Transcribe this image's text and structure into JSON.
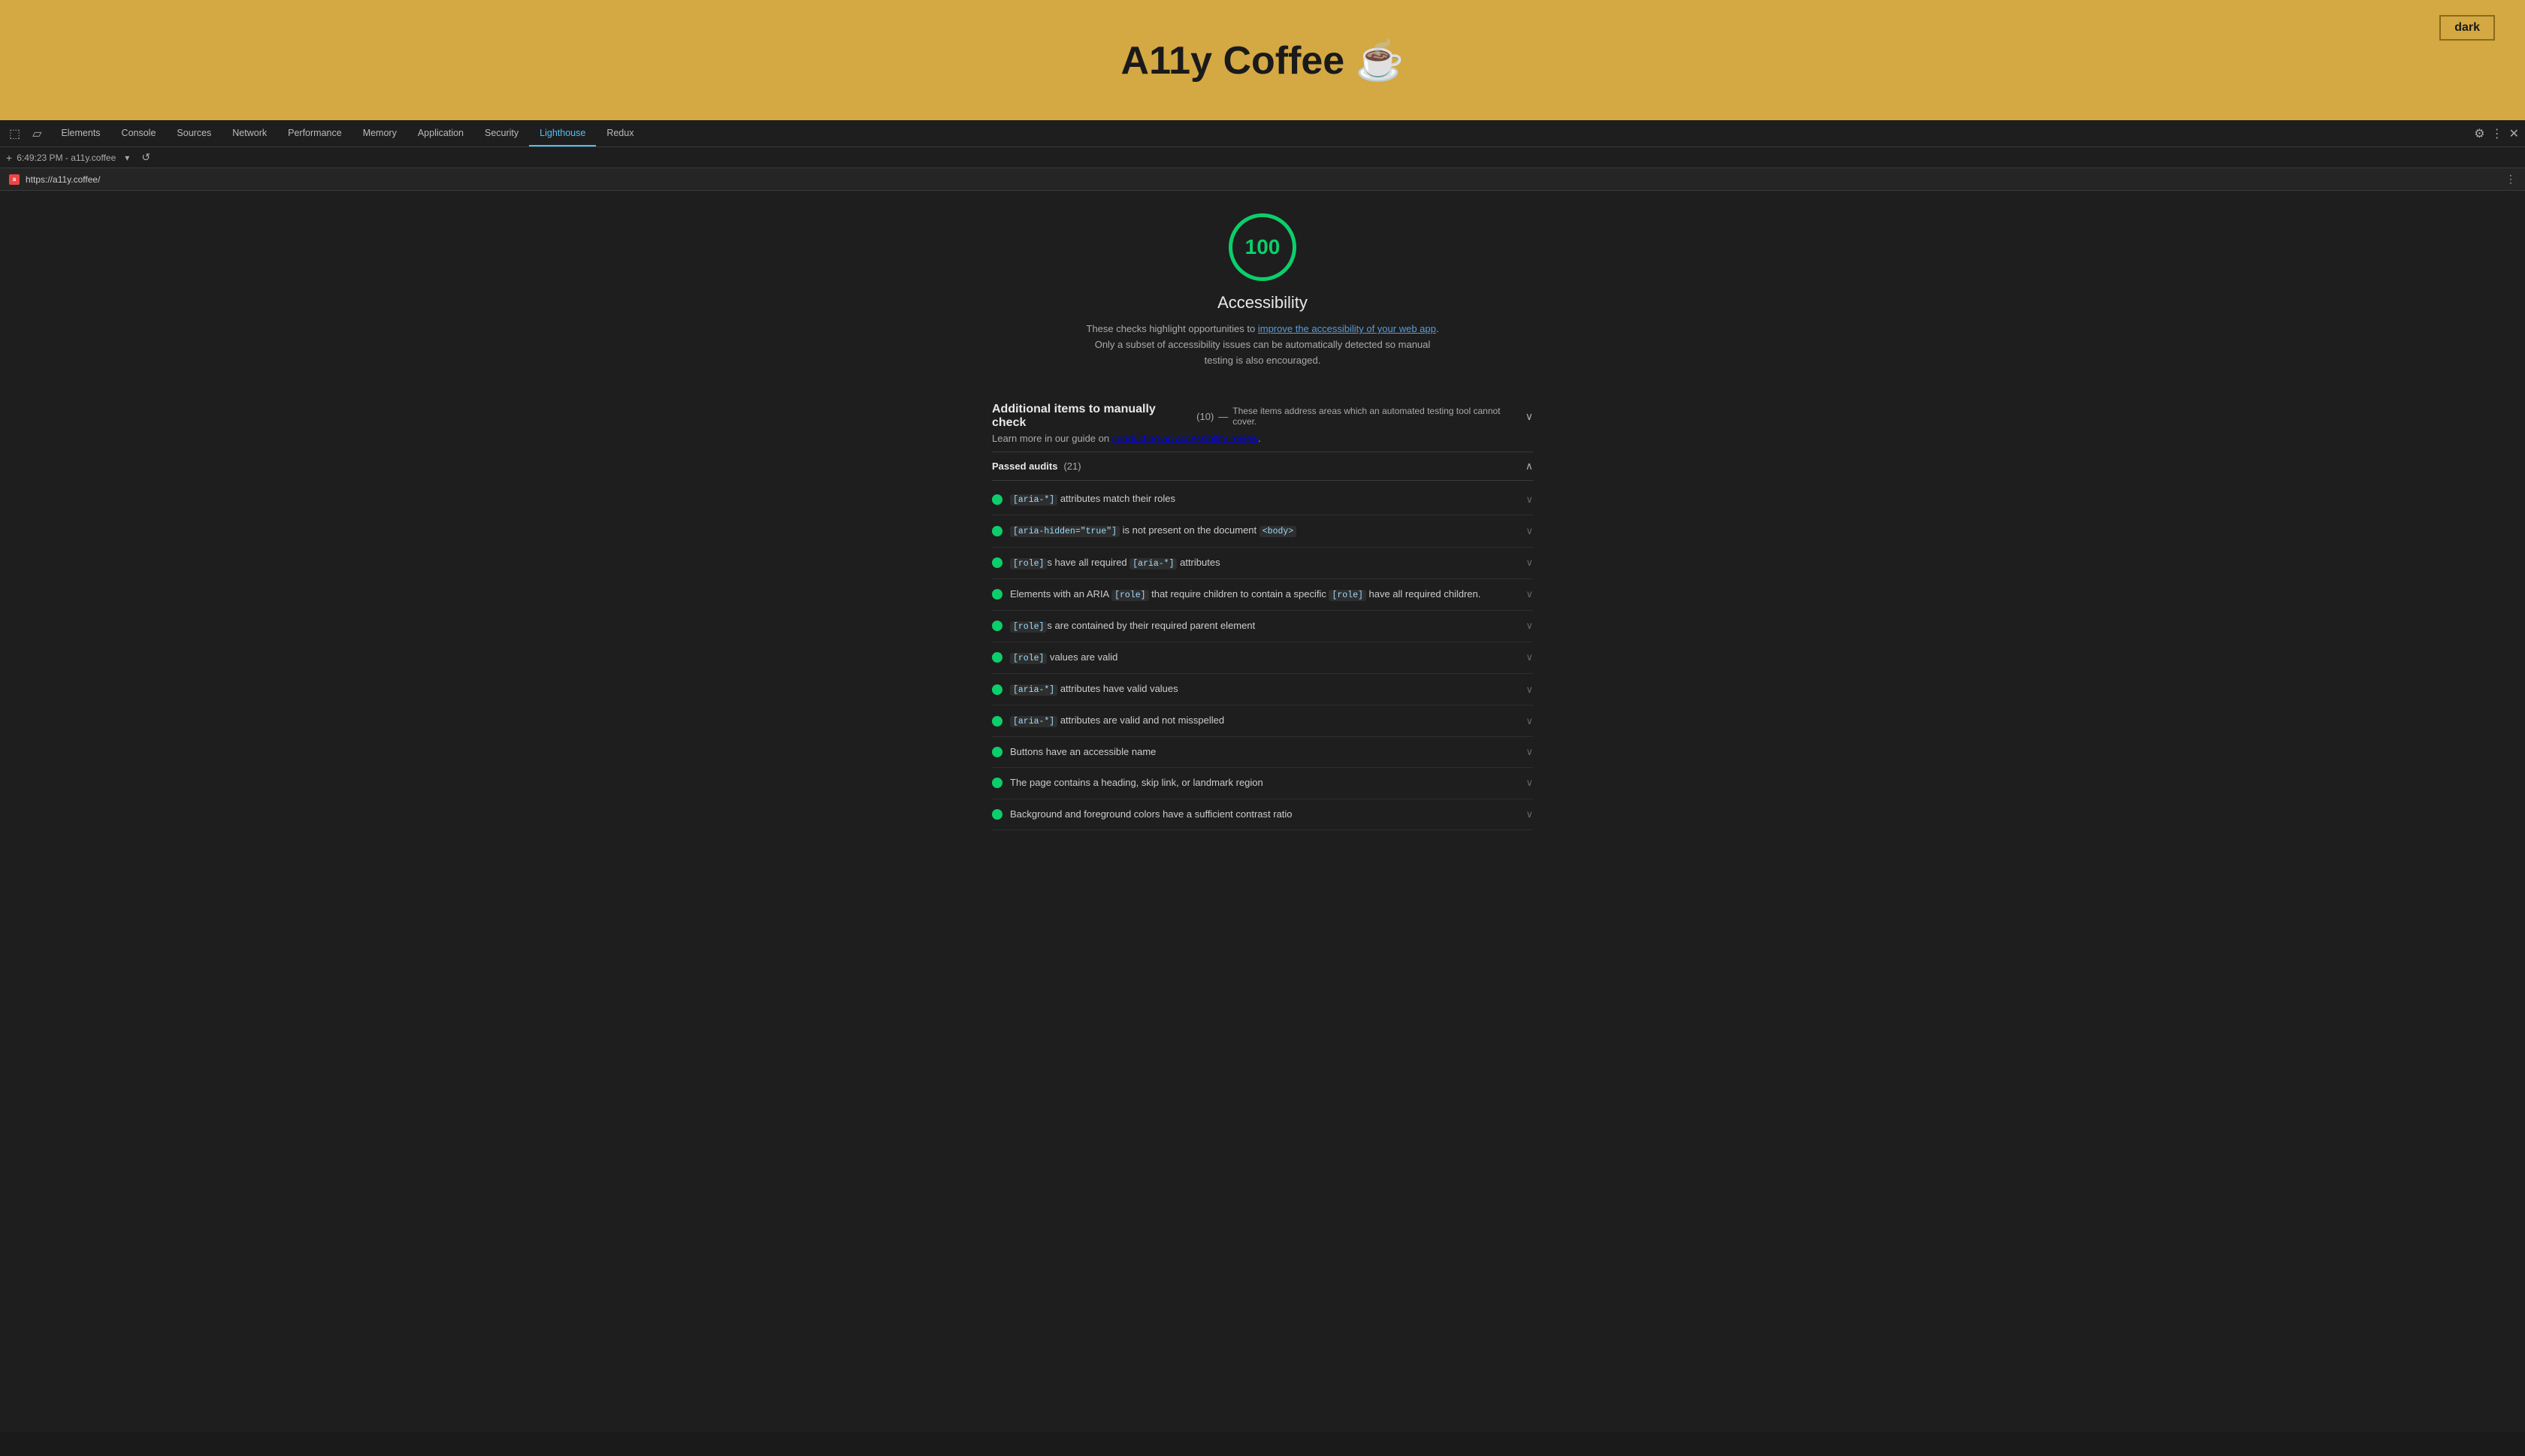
{
  "website": {
    "title": "A11y Coffee",
    "emoji": "☕",
    "dark_button_label": "dark",
    "background_color": "#d4a843"
  },
  "devtools": {
    "tabs": [
      {
        "label": "Elements",
        "active": false
      },
      {
        "label": "Console",
        "active": false
      },
      {
        "label": "Sources",
        "active": false
      },
      {
        "label": "Network",
        "active": false
      },
      {
        "label": "Performance",
        "active": false
      },
      {
        "label": "Memory",
        "active": false
      },
      {
        "label": "Application",
        "active": false
      },
      {
        "label": "Security",
        "active": false
      },
      {
        "label": "Lighthouse",
        "active": true
      },
      {
        "label": "Redux",
        "active": false
      }
    ],
    "secondary_bar": {
      "timestamp": "6:49:23 PM",
      "domain": "a11y.coffee"
    },
    "url": "https://a11y.coffee/"
  },
  "lighthouse": {
    "score": "100",
    "category": "Accessibility",
    "description_part1": "These checks highlight opportunities to ",
    "description_link1_text": "improve the accessibility of your web app",
    "description_link1_href": "#",
    "description_part2": ". Only a subset of accessibility issues can be automatically detected so manual testing is also encouraged.",
    "manual_check": {
      "label": "Additional items to manually check",
      "count": "(10)",
      "dash": "—",
      "note": "These items address areas which an automated testing tool cannot cover.",
      "guide_text": "Learn more in our guide on ",
      "guide_link_text": "conducting an accessibility review",
      "guide_link_href": "#",
      "guide_end": "."
    },
    "passed_audits": {
      "label": "Passed audits",
      "count": "(21)",
      "items": [
        {
          "text_before": "",
          "code1": "[aria-*]",
          "text_middle": " attributes match their roles",
          "code2": ""
        },
        {
          "text_before": "",
          "code1": "[aria-hidden=\"true\"]",
          "text_middle": " is not present on the document ",
          "code2": "<body>"
        },
        {
          "text_before": "",
          "code1": "[role]",
          "text_middle": "s have all required ",
          "code2": "[aria-*]",
          "text_after": " attributes"
        },
        {
          "text_before": "Elements with an ARIA ",
          "code1": "[role]",
          "text_middle": " that require children to contain a specific ",
          "code2": "[role]",
          "text_after": " have all required children."
        },
        {
          "text_before": "",
          "code1": "[role]",
          "text_middle": "s are contained by their required parent element",
          "code2": ""
        },
        {
          "text_before": "",
          "code1": "[role]",
          "text_middle": " values are valid",
          "code2": ""
        },
        {
          "text_before": "",
          "code1": "[aria-*]",
          "text_middle": " attributes have valid values",
          "code2": ""
        },
        {
          "text_before": "",
          "code1": "[aria-*]",
          "text_middle": " attributes are valid and not misspelled",
          "code2": ""
        },
        {
          "text_before": "Buttons have an accessible name",
          "code1": "",
          "text_middle": "",
          "code2": ""
        },
        {
          "text_before": "The page contains a heading, skip link, or landmark region",
          "code1": "",
          "text_middle": "",
          "code2": ""
        },
        {
          "text_before": "Background and foreground colors have a sufficient contrast ratio",
          "code1": "",
          "text_middle": "",
          "code2": ""
        }
      ]
    }
  }
}
